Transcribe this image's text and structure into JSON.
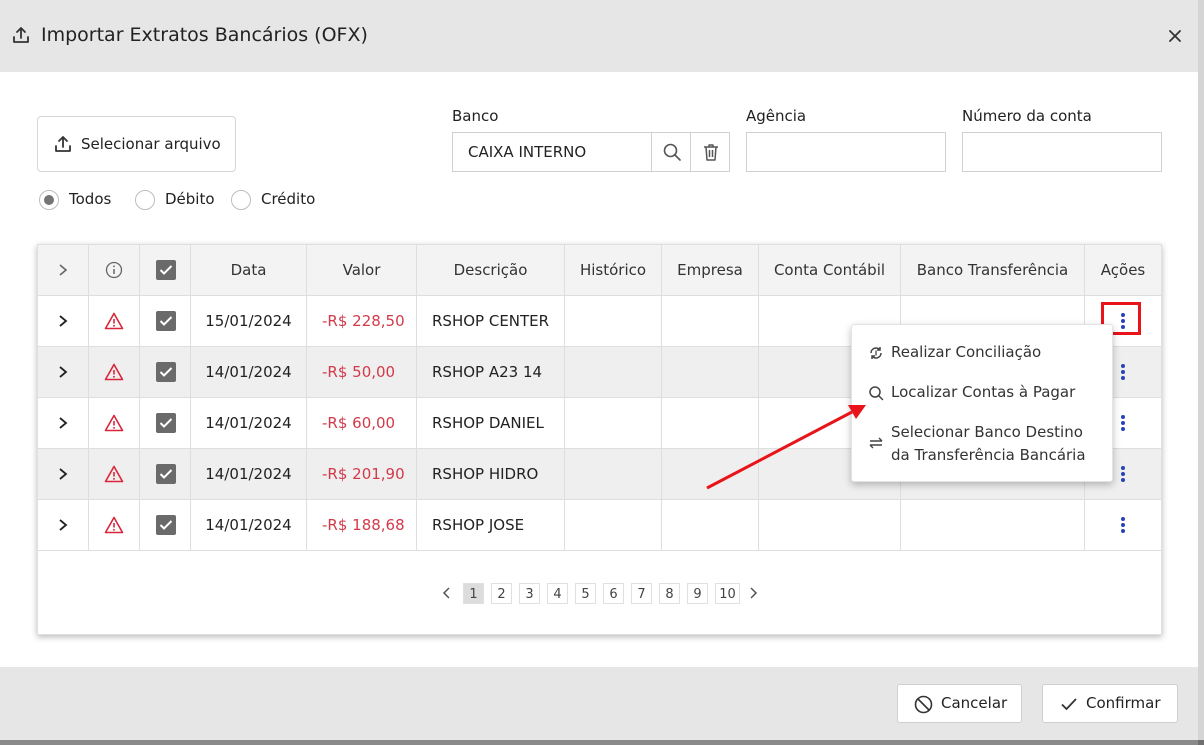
{
  "dialog": {
    "title": "Importar Extratos Bancários (OFX)"
  },
  "toolbar": {
    "select_file_label": "Selecionar arquivo"
  },
  "fields": {
    "bank_label": "Banco",
    "bank_value": "CAIXA INTERNO",
    "agency_label": "Agência",
    "agency_value": "",
    "account_label": "Número da conta",
    "account_value": ""
  },
  "filter": {
    "options": [
      "Todos",
      "Débito",
      "Crédito"
    ],
    "selected": "Todos"
  },
  "table": {
    "headers": [
      "Data",
      "Valor",
      "Descrição",
      "Histórico",
      "Empresa",
      "Conta Contábil",
      "Banco Transferência",
      "Ações"
    ],
    "rows": [
      {
        "date": "15/01/2024",
        "value": "-R$ 228,50",
        "description": "RSHOP CENTER",
        "checked": true
      },
      {
        "date": "14/01/2024",
        "value": "-R$ 50,00",
        "description": "RSHOP A23 14",
        "checked": true
      },
      {
        "date": "14/01/2024",
        "value": "-R$ 60,00",
        "description": "RSHOP DANIEL",
        "checked": true
      },
      {
        "date": "14/01/2024",
        "value": "-R$ 201,90",
        "description": "RSHOP HIDRO",
        "checked": true
      },
      {
        "date": "14/01/2024",
        "value": "-R$ 188,68",
        "description": "RSHOP JOSE",
        "checked": true
      }
    ]
  },
  "pagination": {
    "pages": [
      "1",
      "2",
      "3",
      "4",
      "5",
      "6",
      "7",
      "8",
      "9",
      "10"
    ],
    "current": "1"
  },
  "context_menu": {
    "items": [
      {
        "label": "Realizar Conciliação",
        "icon": "reconcile-icon"
      },
      {
        "label": "Localizar Contas à Pagar",
        "icon": "search-icon"
      },
      {
        "label_line1": "Selecionar Banco Destino",
        "label_line2": "da Transferência Bancária",
        "icon": "transfer-icon"
      }
    ]
  },
  "footer": {
    "cancel_label": "Cancelar",
    "confirm_label": "Confirmar"
  },
  "colors": {
    "negative_value": "#d23a4a",
    "action_dots": "#2643b8",
    "warning_icon": "#d9273a",
    "annotation_red": "#e8141a"
  }
}
